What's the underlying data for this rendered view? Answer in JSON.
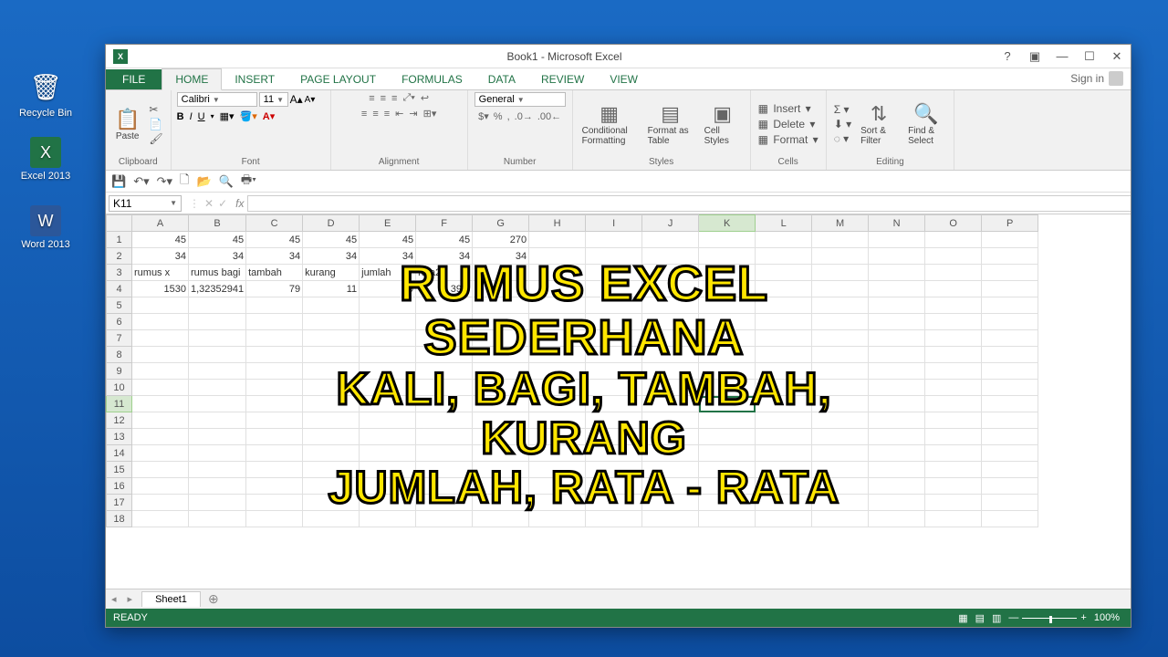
{
  "desktop": {
    "icons": [
      {
        "label": "Recycle Bin",
        "glyph": "🗑"
      },
      {
        "label": "Excel 2013",
        "glyph": "X"
      },
      {
        "label": "Word 2013",
        "glyph": "W"
      }
    ]
  },
  "titlebar": {
    "app_glyph": "X▮",
    "title": "Book1 - Microsoft Excel"
  },
  "tabs": {
    "file": "FILE",
    "items": [
      "HOME",
      "INSERT",
      "PAGE LAYOUT",
      "FORMULAS",
      "DATA",
      "REVIEW",
      "VIEW"
    ],
    "active": "HOME",
    "signin": "Sign in"
  },
  "ribbon": {
    "clipboard": {
      "paste": "Paste",
      "label": "Clipboard"
    },
    "font": {
      "name": "Calibri",
      "size": "11",
      "label": "Font"
    },
    "alignment": {
      "label": "Alignment"
    },
    "number": {
      "format": "General",
      "label": "Number"
    },
    "styles": {
      "cond": "Conditional Formatting",
      "fmt": "Format as Table",
      "cell": "Cell Styles",
      "label": "Styles"
    },
    "cells": {
      "ins": "Insert",
      "del": "Delete",
      "fmt": "Format",
      "label": "Cells"
    },
    "editing": {
      "sort": "Sort & Filter",
      "find": "Find & Select",
      "label": "Editing"
    }
  },
  "formula_bar": {
    "cell": "K11",
    "fx": "fx"
  },
  "columns": [
    "A",
    "B",
    "C",
    "D",
    "E",
    "F",
    "G",
    "H",
    "I",
    "J",
    "K",
    "L",
    "M",
    "N",
    "O",
    "P"
  ],
  "active_col": "K",
  "rows": [
    1,
    2,
    3,
    4,
    5,
    6,
    7,
    8,
    9,
    10,
    11,
    12,
    13,
    14,
    15,
    16,
    17,
    18
  ],
  "active_row": 11,
  "celldata": {
    "1": {
      "A": "45",
      "B": "45",
      "C": "45",
      "D": "45",
      "E": "45",
      "F": "45",
      "G": "270"
    },
    "2": {
      "A": "34",
      "B": "34",
      "C": "34",
      "D": "34",
      "E": "34",
      "F": "34",
      "G": "34"
    },
    "3": {
      "A": "rumus x",
      "B": "rumus bagi",
      "C": "tambah",
      "D": "kurang",
      "E": "jumlah",
      "F": "rata2"
    },
    "4": {
      "A": "1530",
      "B": "1,32352941",
      "C": "79",
      "D": "11",
      "E": "79",
      "F": "39,5"
    }
  },
  "text_cells": [
    "3A",
    "3B",
    "3C",
    "3D",
    "3E",
    "3F"
  ],
  "sheet": {
    "name": "Sheet1"
  },
  "statusbar": {
    "ready": "READY",
    "zoom": "100%"
  },
  "overlay": {
    "l1": "RUMUS EXCEL SEDERHANA",
    "l2": "KALI, BAGI, TAMBAH, KURANG",
    "l3": "JUMLAH, RATA - RATA"
  }
}
